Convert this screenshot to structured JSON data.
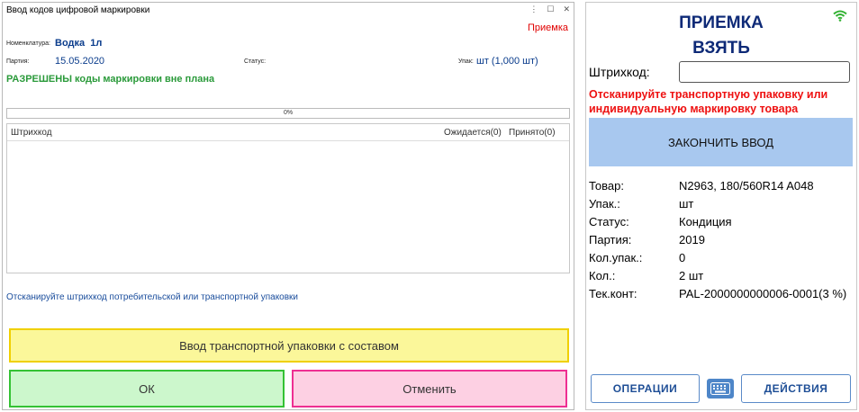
{
  "left": {
    "window_title": "Ввод кодов цифровой маркировки",
    "window_controls": [
      "⋮",
      "☐",
      "✕"
    ],
    "mode": "Приемка",
    "nomenclature_label": "Номенклатура:",
    "nomenclature_value": "Водка  1л",
    "batch_label": "Партия:",
    "batch_value": "15.05.2020",
    "status_label": "Статус:",
    "pack_label": "Упак:",
    "pack_value": "шт (1,000 шт)",
    "allowed_bold": "РАЗРЕШЕНЫ",
    "allowed_rest": " коды маркировки вне плана",
    "progress_percent": 0,
    "progress_text": "0%",
    "table_headers": {
      "barcode": "Штрихкод",
      "expected": "Ожидается(0)",
      "accepted": "Принято(0)"
    },
    "hint": "Отсканируйте штрихкод потребительской или транспортной упаковки",
    "btn_transport": "Ввод транспортной упаковки с составом",
    "btn_ok": "ОК",
    "btn_cancel": "Отменить",
    "colors": {
      "accent_blue": "#0a3c8c",
      "mode_red": "#e00000",
      "allowed_green": "#2a9a3a"
    }
  },
  "right": {
    "title1": "ПРИЕМКА",
    "title2": "ВЗЯТЬ",
    "wifi_icon": "wifi-icon",
    "barcode_label": "Штрихкод:",
    "barcode_value": "",
    "warning": "Отсканируйте транспортную упаковку или индивидуальную маркировку товара",
    "finish_btn": "ЗАКОНЧИТЬ ВВОД",
    "info": {
      "item_label": "Товар:",
      "item_value": "N2963, 180/560R14 A048",
      "pack_label": "Упак.:",
      "pack_value": "шт",
      "status_label": "Статус:",
      "status_value": "Кондиция",
      "batch_label": "Партия:",
      "batch_value": "2019",
      "qtypack_label": "Кол.упак.:",
      "qtypack_value": "0",
      "qty_label": "Кол.:",
      "qty_value": "2 шт",
      "cont_label": "Тек.конт:",
      "cont_value": "PAL-2000000000006-0001(3 %)"
    },
    "btn_operations": "ОПЕРАЦИИ",
    "btn_actions": "ДЕЙСТВИЯ",
    "keyboard_icon": "keyboard-icon",
    "colors": {
      "title_blue": "#0e2a77",
      "warn_red": "#ee1111",
      "finish_bg": "#a8c8ef"
    }
  }
}
